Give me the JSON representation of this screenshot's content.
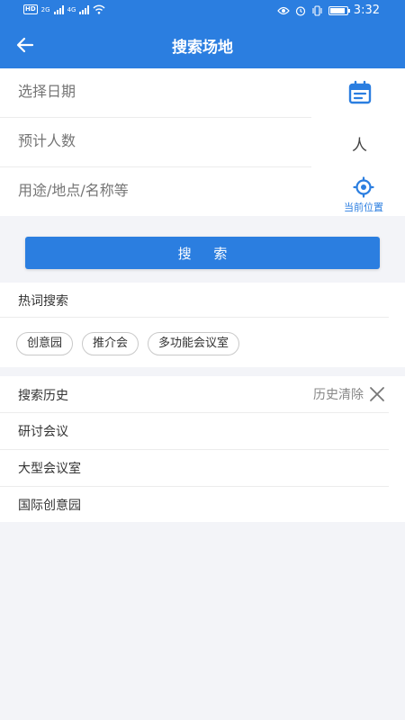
{
  "status_bar": {
    "hd": "HD",
    "net1": "2G",
    "net2": "4G",
    "time": "3:32",
    "battery_percent": 90
  },
  "app_bar": {
    "title": "搜索场地",
    "back_icon": "arrow-left-icon"
  },
  "form": {
    "date_placeholder": "选择日期",
    "people_placeholder": "预计人数",
    "people_unit": "人",
    "purpose_placeholder": "用途/地点/名称等",
    "location_label": "当前位置",
    "calendar_icon": "calendar-icon",
    "location_icon": "location-target-icon"
  },
  "search_button": "搜  索",
  "hot": {
    "title": "热词搜索",
    "tags": [
      "创意园",
      "推介会",
      "多功能会议室"
    ]
  },
  "history": {
    "title": "搜索历史",
    "clear_label": "历史清除",
    "items": [
      "研讨会议",
      "大型会议室",
      "国际创意园"
    ]
  },
  "colors": {
    "primary": "#2b7ee0",
    "background": "#f3f4f8",
    "placeholder": "#9a9a9a"
  }
}
